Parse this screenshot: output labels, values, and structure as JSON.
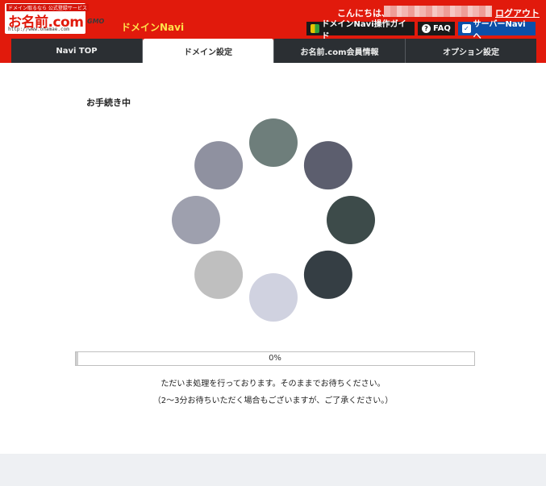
{
  "header": {
    "logo": {
      "tagline": "ドメイン取るなら 公式登録サービス",
      "brand": "お名前.com",
      "url": "http://www.onamae.com"
    },
    "company": "GMO",
    "app_name": "ドメインNavi",
    "greeting": "こんにちは、",
    "logout": "ログアウト",
    "buttons": {
      "guide": "ドメインNavi操作ガイド",
      "faq": "FAQ",
      "server": "サーバーNaviへ"
    },
    "icons": {
      "guide": "beginner-mark-icon",
      "faq": "question-icon",
      "server": "server-navi-icon"
    }
  },
  "tabs": [
    {
      "label": "Navi TOP",
      "active": false
    },
    {
      "label": "ドメイン設定",
      "active": true
    },
    {
      "label": "お名前.com会員情報",
      "active": false
    },
    {
      "label": "オプション設定",
      "active": false
    }
  ],
  "main": {
    "status_title": "お手続き中",
    "spinner_colors": [
      "#6e7e7b",
      "#5c5e6e",
      "#3d4b4a",
      "#353e44",
      "#d0d2e0",
      "#bfbfbf",
      "#9ea0ae",
      "#8f91a0"
    ],
    "progress": {
      "percent": 0,
      "label": "0%"
    },
    "message1": "ただいま処理を行っております。そのままでお待ちください。",
    "message2": "（2〜3分お待ちいただく場合もございますが、ご了承ください。）"
  },
  "colors": {
    "header_red": "#e11a0c",
    "app_name_yellow": "#ffe14a",
    "tab_dark": "#2b2f33",
    "server_blue": "#0b4fa8"
  }
}
